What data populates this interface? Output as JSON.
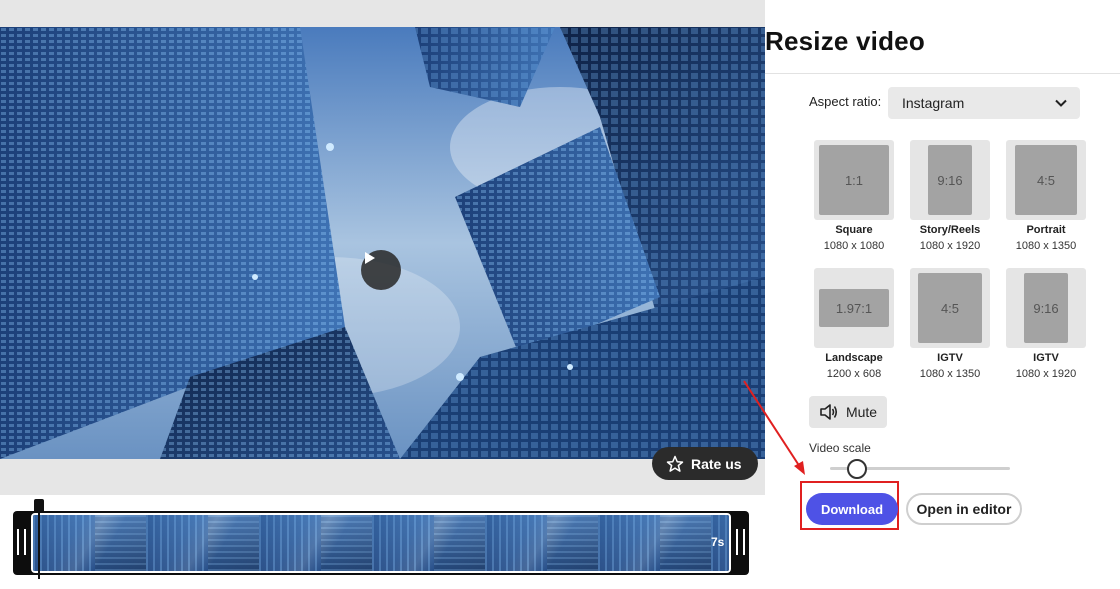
{
  "panel": {
    "title": "Resize video",
    "aspect_label": "Aspect ratio:",
    "aspect_value": "Instagram",
    "presets": [
      {
        "ratio": "1:1",
        "name": "Square",
        "dims": "1080 x 1080"
      },
      {
        "ratio": "9:16",
        "name": "Story/Reels",
        "dims": "1080 x 1920"
      },
      {
        "ratio": "4:5",
        "name": "Portrait",
        "dims": "1080 x 1350"
      },
      {
        "ratio": "1.97:1",
        "name": "Landscape",
        "dims": "1200 x 608"
      },
      {
        "ratio": "4:5",
        "name": "IGTV",
        "dims": "1080 x 1350"
      },
      {
        "ratio": "9:16",
        "name": "IGTV",
        "dims": "1080 x 1920"
      }
    ],
    "mute_label": "Mute",
    "scale_label": "Video scale",
    "scale_value": 0.15,
    "download_label": "Download",
    "editor_label": "Open in editor"
  },
  "video": {
    "rate_label": "Rate us",
    "duration": "7s"
  },
  "colors": {
    "accent": "#4e52e6",
    "highlight": "#e02020"
  },
  "icons": [
    "play-icon",
    "star-icon",
    "chevron-down-icon",
    "speaker-icon"
  ]
}
